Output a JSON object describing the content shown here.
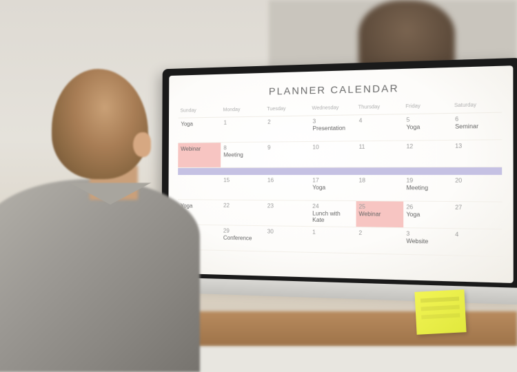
{
  "calendar": {
    "title": "PLANNER CALENDAR",
    "day_headers": [
      "Sunday",
      "Monday",
      "Tuesday",
      "Wednesday",
      "Thursday",
      "Friday",
      "Saturday"
    ],
    "rows": [
      [
        {
          "num": "",
          "evt": "Yoga"
        },
        {
          "num": "1",
          "evt": ""
        },
        {
          "num": "2",
          "evt": ""
        },
        {
          "num": "3",
          "evt": "Presentation"
        },
        {
          "num": "4",
          "evt": ""
        },
        {
          "num": "5",
          "evt": "Yoga"
        },
        {
          "num": "6",
          "evt": "Seminar"
        }
      ],
      [
        {
          "num": "",
          "evt": "Webinar",
          "hl": "pink"
        },
        {
          "num": "8",
          "evt": "Meeting"
        },
        {
          "num": "9",
          "evt": ""
        },
        {
          "num": "10",
          "evt": ""
        },
        {
          "num": "11",
          "evt": ""
        },
        {
          "num": "12",
          "evt": ""
        },
        {
          "num": "13",
          "evt": ""
        }
      ],
      [
        {
          "num": "",
          "evt": ""
        },
        {
          "num": "15",
          "evt": ""
        },
        {
          "num": "16",
          "evt": ""
        },
        {
          "num": "17",
          "evt": "Yoga"
        },
        {
          "num": "18",
          "evt": ""
        },
        {
          "num": "19",
          "evt": "Meeting"
        },
        {
          "num": "20",
          "evt": ""
        }
      ],
      [
        {
          "num": "",
          "evt": "Yoga"
        },
        {
          "num": "22",
          "evt": ""
        },
        {
          "num": "23",
          "evt": ""
        },
        {
          "num": "24",
          "evt": "Lunch with Kate"
        },
        {
          "num": "25",
          "evt": "Webinar",
          "hl": "pink"
        },
        {
          "num": "26",
          "evt": "Yoga"
        },
        {
          "num": "27",
          "evt": ""
        }
      ],
      [
        {
          "num": "",
          "evt": ""
        },
        {
          "num": "29",
          "evt": "Conference"
        },
        {
          "num": "30",
          "evt": ""
        },
        {
          "num": "1",
          "evt": ""
        },
        {
          "num": "2",
          "evt": ""
        },
        {
          "num": "3",
          "evt": "Website"
        },
        {
          "num": "4",
          "evt": ""
        }
      ]
    ]
  }
}
